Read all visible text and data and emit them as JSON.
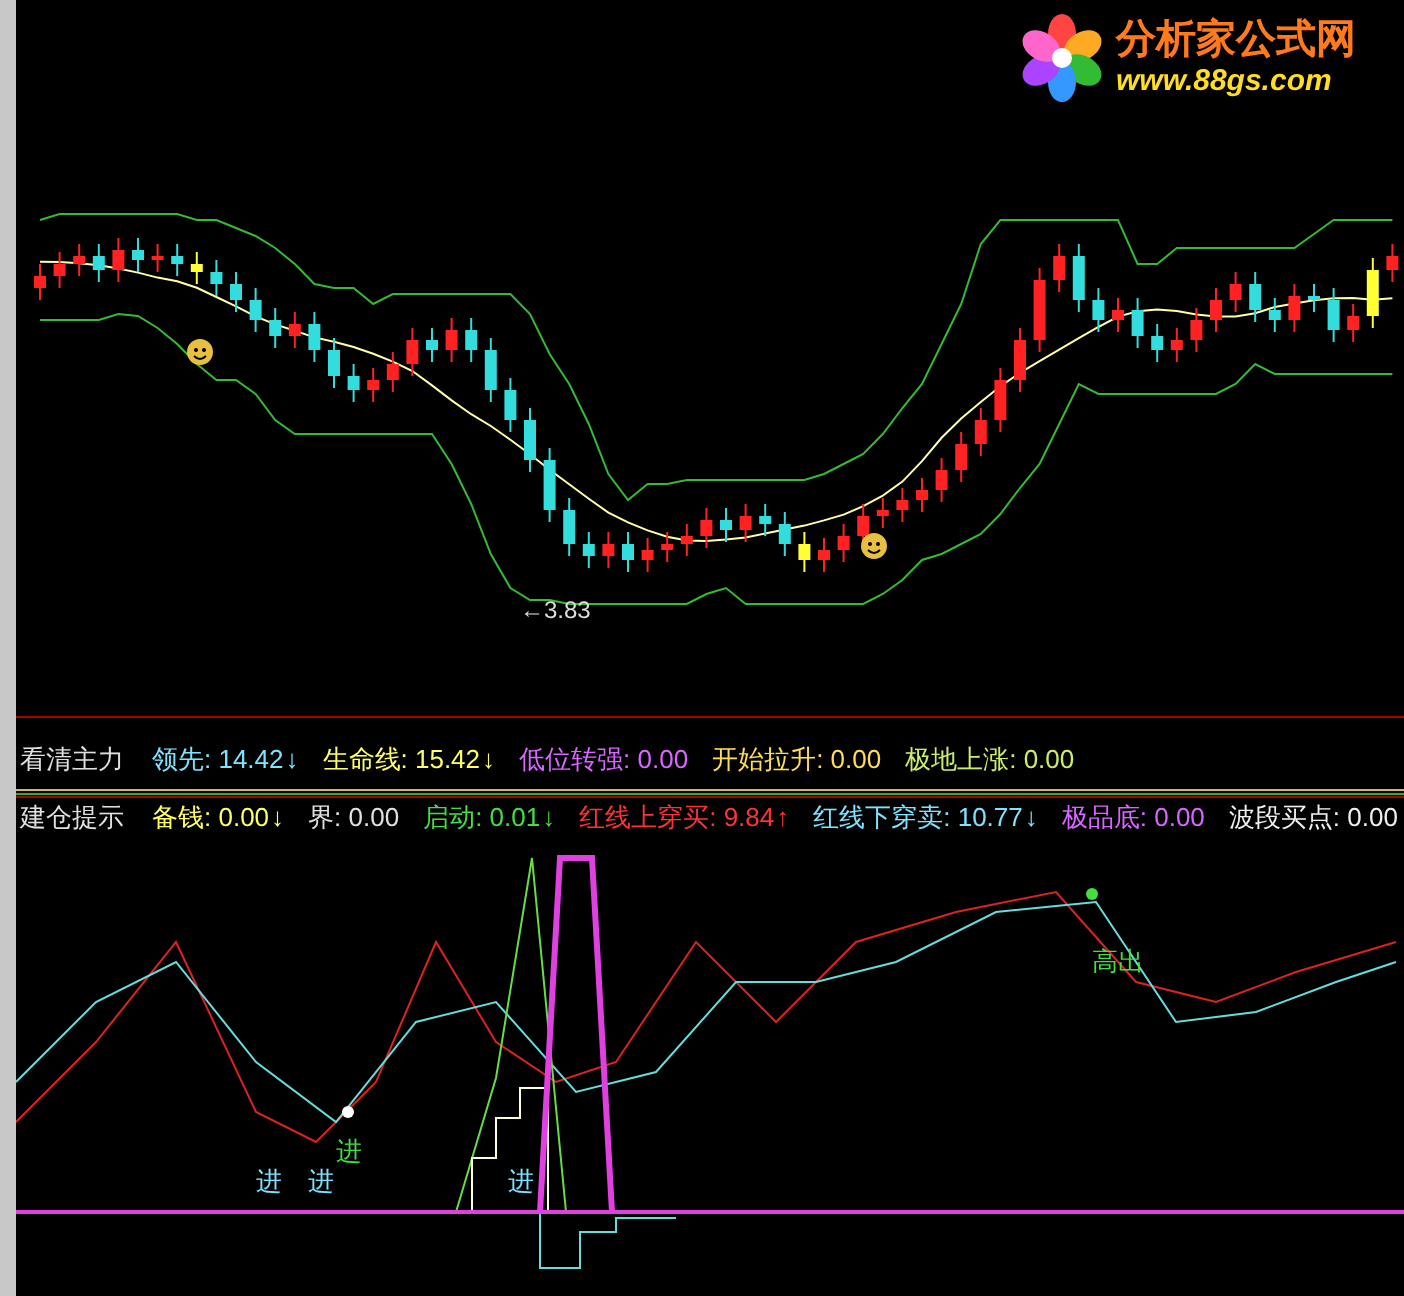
{
  "logo": {
    "title": "分析家公式网",
    "url": "www.88gs.com"
  },
  "price_chart": {
    "low_label": "←3.83"
  },
  "panels": [
    {
      "title": "看清主力",
      "items": [
        {
          "text": "领先: 14.42",
          "arrow": "↓",
          "color": "#7fe3ff"
        },
        {
          "text": "生命线: 15.42",
          "arrow": "↓",
          "color": "#ffff66"
        },
        {
          "text": "低位转强: 0.00",
          "color": "#d966ff"
        },
        {
          "text": "开始拉升: 0.00",
          "color": "#ffdd55"
        },
        {
          "text": "极地上涨: 0.00",
          "color": "#ccee66"
        }
      ]
    },
    {
      "title": "建仓提示",
      "items": [
        {
          "text": "备钱: 0.00",
          "arrow": "↓",
          "color": "#ffff66"
        },
        {
          "text": "界: 0.00",
          "color": "#e0e0e0"
        },
        {
          "text": "启动: 0.01",
          "arrow": "↓",
          "color": "#44dd44"
        },
        {
          "text": "红线上穿买: 9.84",
          "arrow": "↑",
          "color": "#ff3333"
        },
        {
          "text": "红线下穿卖: 10.77",
          "arrow": "↓",
          "color": "#7fe3ff"
        },
        {
          "text": "极品底: 0.00",
          "color": "#d966ff"
        },
        {
          "text": "波段买点: 0.00",
          "color": "#f0f0f0"
        }
      ]
    }
  ],
  "signals": [
    {
      "text": "高出",
      "color": "#44dd44"
    },
    {
      "text": "进",
      "color": "#7fe3ff"
    },
    {
      "text": "进",
      "color": "#7fe3ff"
    },
    {
      "text": "进",
      "color": "#44dd44"
    },
    {
      "text": "进",
      "color": "#7fe3ff"
    }
  ]
}
